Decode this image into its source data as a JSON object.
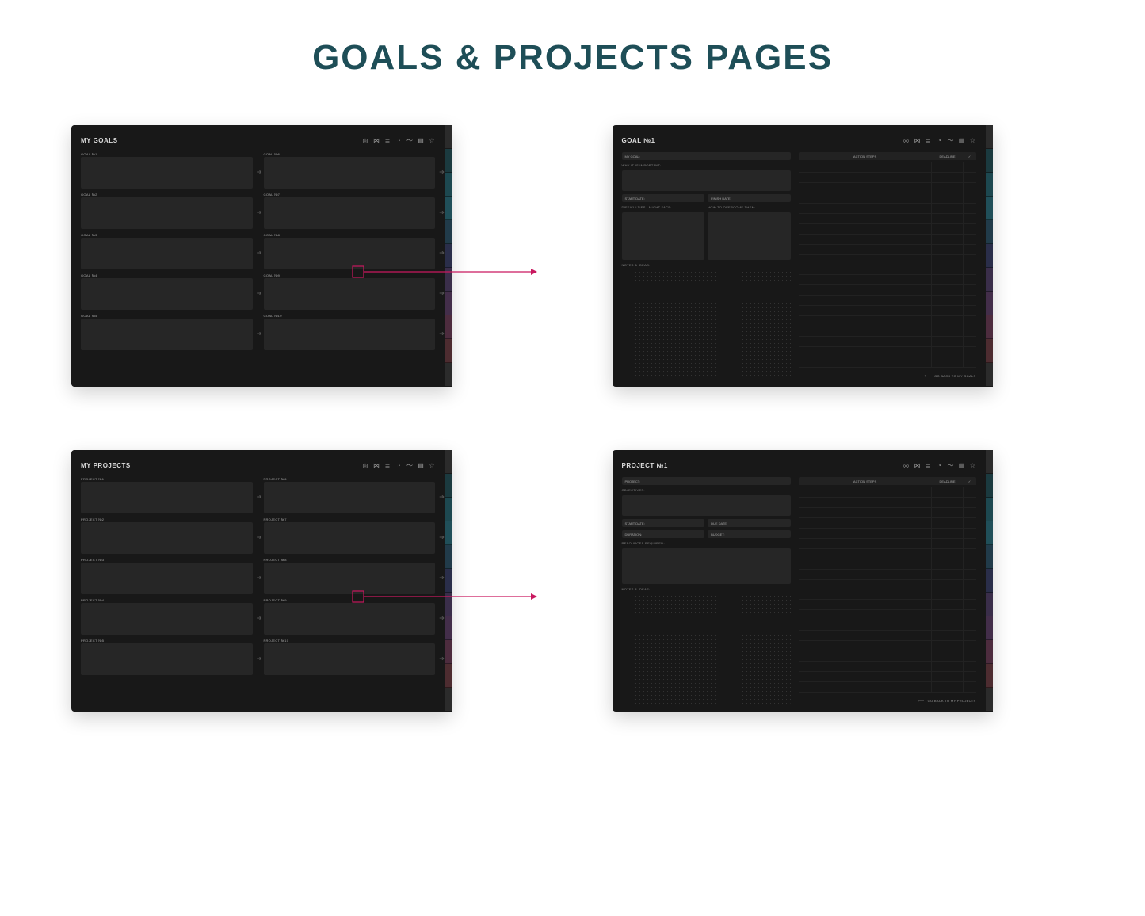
{
  "title": "GOALS & PROJECTS PAGES",
  "header_icons": [
    "target-icon",
    "dumbbell-icon",
    "list-icon",
    "clock-icon",
    "chart-icon",
    "bookmark-icon",
    "star-icon"
  ],
  "goals_overview": {
    "title": "MY GOALS",
    "left": [
      "GOAL №1",
      "GOAL №2",
      "GOAL №3",
      "GOAL №4",
      "GOAL №5"
    ],
    "right": [
      "GOAL №6",
      "GOAL №7",
      "GOAL №8",
      "GOAL №9",
      "GOAL №10"
    ]
  },
  "goal_detail": {
    "title": "GOAL №1",
    "my_goal": "MY GOAL:",
    "why": "WHY IT IS IMPORTANT:",
    "start": "START DATE:",
    "finish": "FINISH DATE:",
    "difficulties": "DIFFICULTIES I MIGHT FACE:",
    "overcome": "HOW TO OVERCOME THEM:",
    "notes": "NOTES & IDEAS:",
    "action_steps": "ACTION STEPS",
    "deadline": "DEADLINE",
    "check": "✓",
    "back": "GO BACK TO MY GOALS"
  },
  "projects_overview": {
    "title": "MY PROJECTS",
    "left": [
      "PROJECT №1",
      "PROJECT №2",
      "PROJECT №3",
      "PROJECT №4",
      "PROJECT №5"
    ],
    "right": [
      "PROJECT №6",
      "PROJECT №7",
      "PROJECT №8",
      "PROJECT №9",
      "PROJECT №10"
    ]
  },
  "project_detail": {
    "title": "PROJECT №1",
    "project": "PROJECT:",
    "objectives": "OBJECTIVES:",
    "start": "START DATE:",
    "due": "DUE DATE:",
    "duration": "DURATION:",
    "budget": "BUDGET:",
    "resources": "RESOURCES REQUIRED:",
    "notes": "NOTES & IDEAS:",
    "action_steps": "ACTION STEPS",
    "deadline": "DEADLINE",
    "check": "✓",
    "back": "GO BACK TO MY PROJECTS"
  }
}
